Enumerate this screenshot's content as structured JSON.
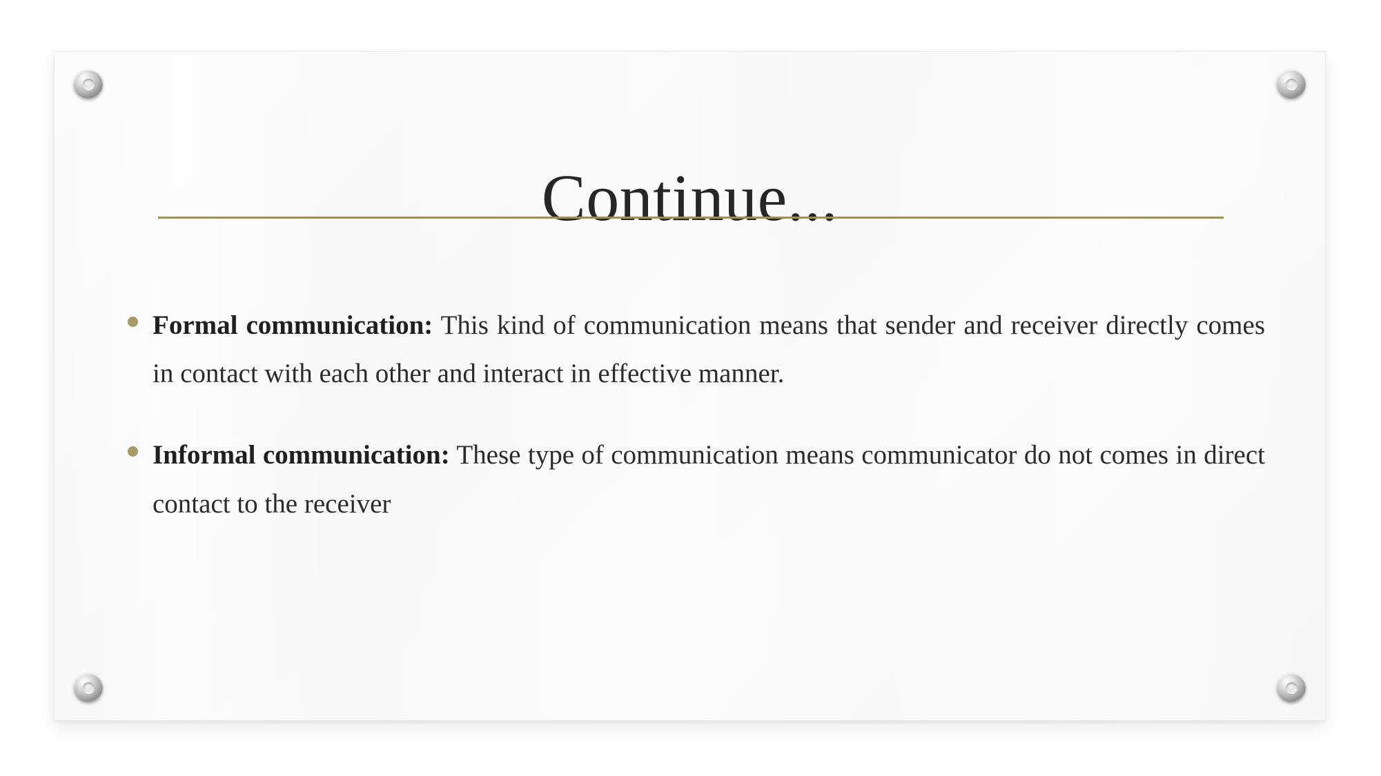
{
  "slide": {
    "title": "Continue...",
    "accent_color": "#a08f5e",
    "bullet_color": "#a89968",
    "panel_color": "#f8f8f8",
    "text_color": "#2b2b2b"
  },
  "bullets": [
    {
      "lead": "Formal communication:",
      "rest": " This kind of communication means that sender and receiver directly comes in contact with each other and interact in effective manner."
    },
    {
      "lead": "Informal communication:",
      "rest": " These type of communication means communicator do not comes in direct contact to the receiver"
    }
  ],
  "decor": {
    "grommet_top_left": "screw-washer-icon",
    "grommet_top_right": "screw-washer-icon",
    "grommet_bottom_left": "screw-washer-icon",
    "grommet_bottom_right": "screw-washer-icon"
  }
}
